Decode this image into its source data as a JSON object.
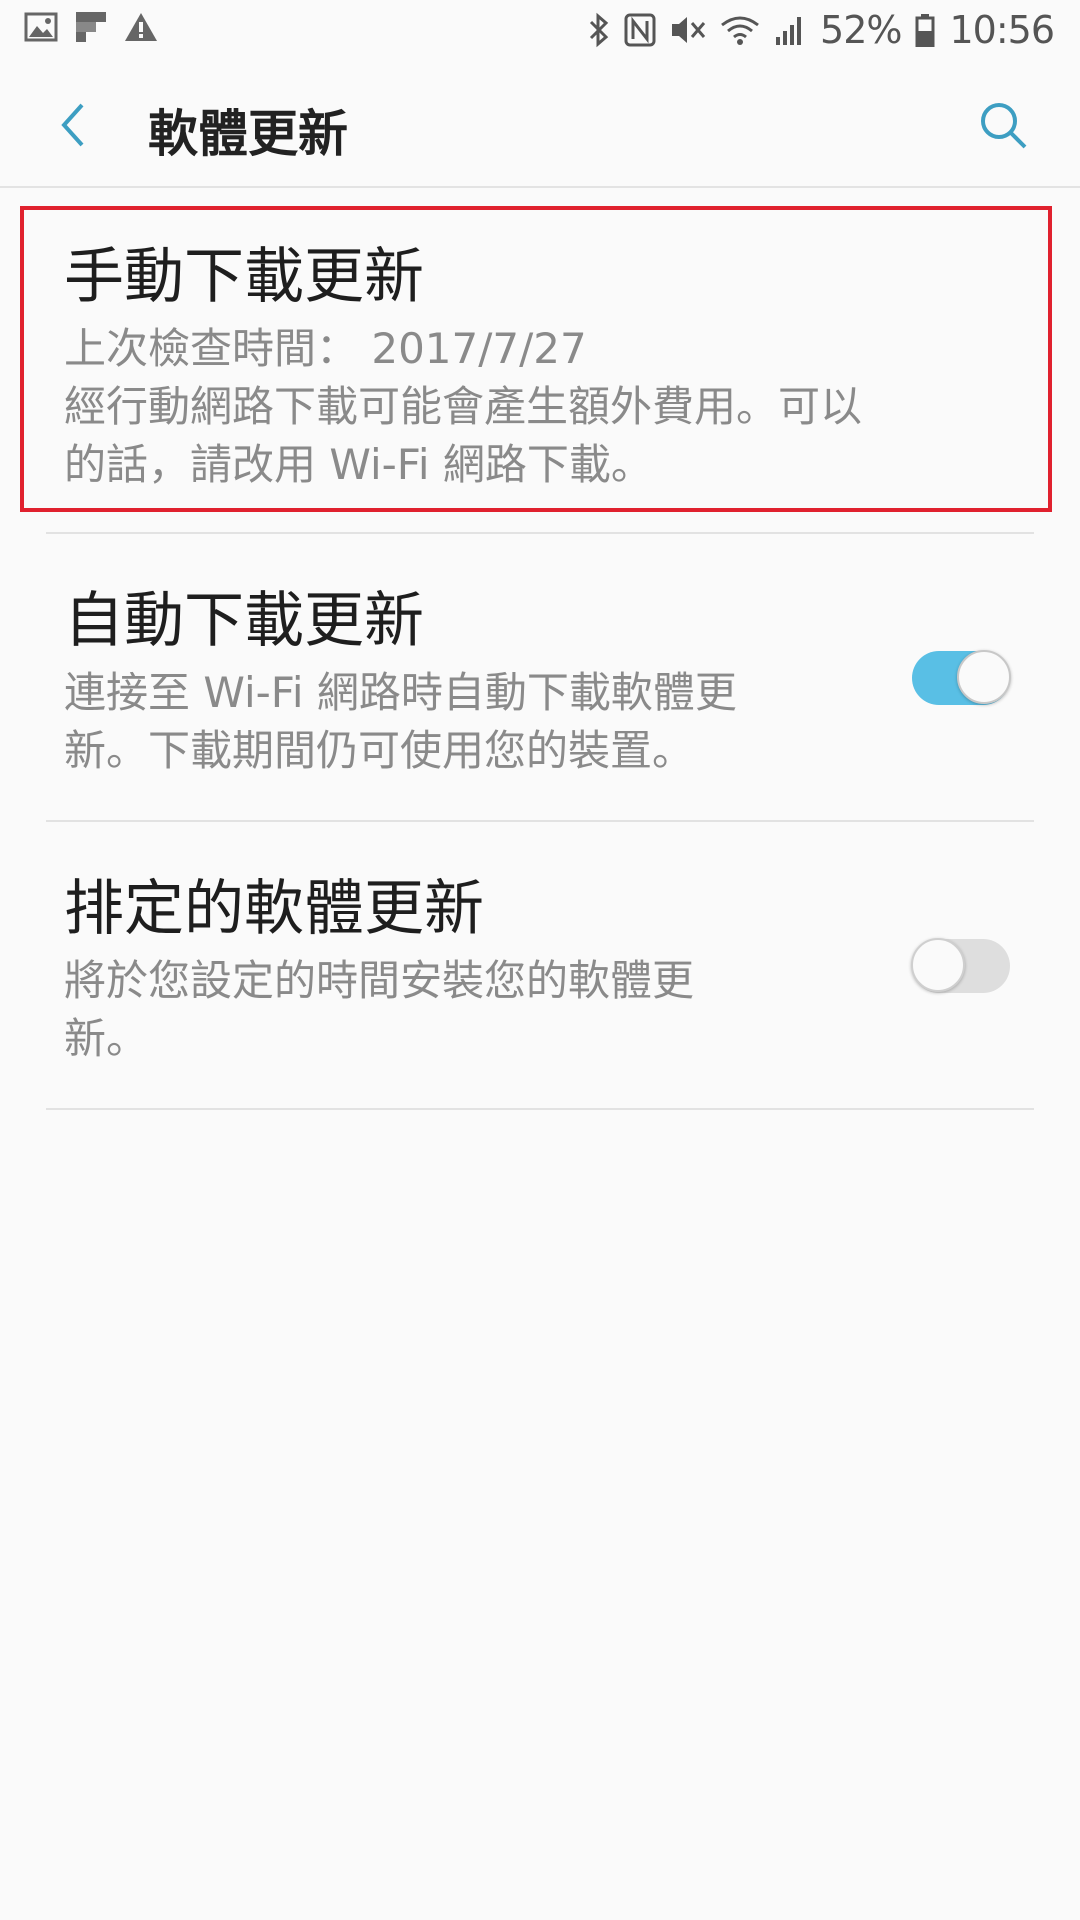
{
  "status_bar": {
    "battery": "52%",
    "time": "10:56",
    "left_icons": [
      "image-icon",
      "flipboard-icon",
      "warning-icon"
    ],
    "right_icons": [
      "bluetooth-icon",
      "nfc-icon",
      "mute-icon",
      "wifi-icon",
      "signal-icon",
      "battery-icon"
    ]
  },
  "header": {
    "title": "軟體更新",
    "back_icon": "chevron-left-icon",
    "search_icon": "search-icon",
    "accent_color": "#3d9ec2"
  },
  "items": [
    {
      "title": "手動下載更新",
      "lines": [
        "上次檢查時間： 2017/7/27",
        "經行動網路下載可能會產生額外費用。可以",
        "的話，請改用 Wi-Fi 網路下載。"
      ],
      "highlighted": true
    },
    {
      "title": "自動下載更新",
      "lines": [
        "連接至 Wi-Fi 網路時自動下載軟體更",
        "新。下載期間仍可使用您的裝置。"
      ],
      "toggle_on": true
    },
    {
      "title": "排定的軟體更新",
      "lines": [
        "將於您設定的時間安裝您的軟體更",
        "新。"
      ],
      "toggle_on": false
    }
  ],
  "colors": {
    "toggle_on": "#59bfe5",
    "toggle_off": "#dedede",
    "highlight_border": "#e0212e"
  }
}
